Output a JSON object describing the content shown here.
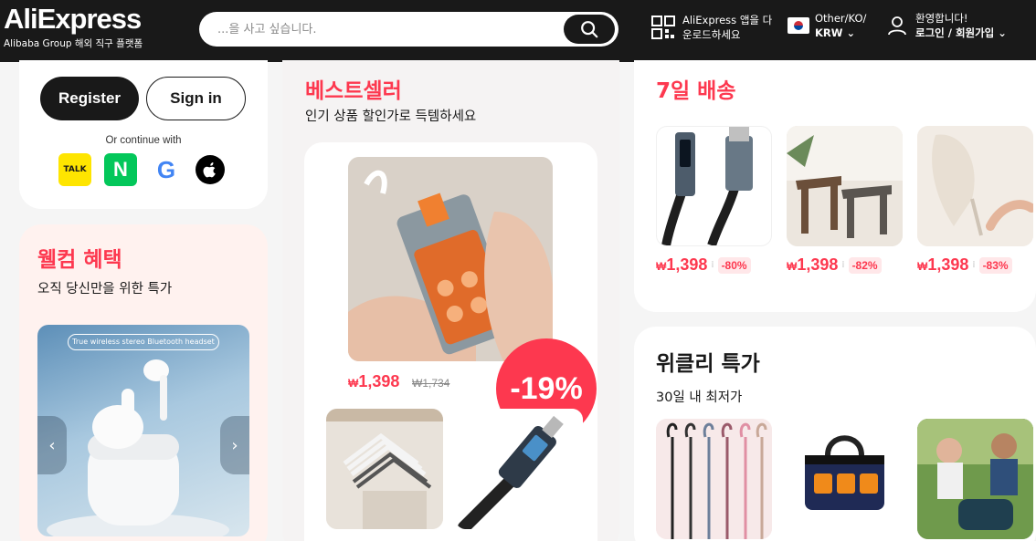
{
  "header": {
    "logo": "AliExpress",
    "logo_sub": "Alibaba Group 해외 직구 플랫폼",
    "search_placeholder": "...을 사고 싶습니다.",
    "app_download_line1": "AliExpress 앱을 다",
    "app_download_line2": "운로드하세요",
    "region_line1": "Other/KO/",
    "region_line2": "KRW",
    "account_line1": "환영합니다!",
    "account_line2": "로그인 / 회원가입"
  },
  "login": {
    "register_label": "Register",
    "signin_label": "Sign in",
    "continue_text": "Or continue with",
    "kakao_label": "TALK",
    "naver_label": "N",
    "google_label": "G"
  },
  "welcome": {
    "title": "웰컴 혜택",
    "subtitle": "오직 당신만을 위한 특가",
    "banner_tag": "True wireless stereo Bluetooth headset"
  },
  "bestseller": {
    "title": "베스트셀러",
    "subtitle": "인기 상품 할인가로 득템하세요",
    "currency": "₩",
    "price": "1,398",
    "old_price": "₩1,734",
    "discount": "-19%"
  },
  "delivery": {
    "title": "7일 배송",
    "items": [
      {
        "currency": "₩",
        "price": "1,398",
        "discount": "-80%"
      },
      {
        "currency": "₩",
        "price": "1,398",
        "discount": "-82%"
      },
      {
        "currency": "₩",
        "price": "1,398",
        "discount": "-83%"
      }
    ]
  },
  "weekly": {
    "title": "위클리 특가",
    "subtitle": "30일 내 최저가"
  },
  "colors": {
    "accent": "#fd384f",
    "header_bg": "#191919"
  }
}
